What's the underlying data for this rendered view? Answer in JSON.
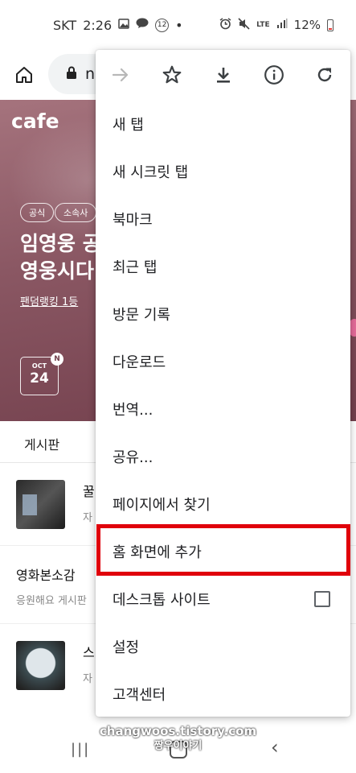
{
  "status_bar": {
    "carrier": "SKT",
    "time": "2:26",
    "icons_left": [
      "image-icon",
      "talk-icon"
    ],
    "notification_count": "12",
    "dot": "•",
    "icons_right": [
      "alarm-icon",
      "mute-icon",
      "lte-icon",
      "signal-icon"
    ],
    "lte_label": "LTE",
    "battery_percent": "12%",
    "battery_icon": "battery-low-icon"
  },
  "toolbar": {
    "home_icon": "home-icon",
    "lock_icon": "lock-icon",
    "url_text": "n"
  },
  "page": {
    "logo": "cafe",
    "chips": [
      "공식",
      "소속사"
    ],
    "title": "임영웅 공\n영웅시다",
    "rank_text": "팬덤랭킹 1등",
    "calendar": {
      "month": "OCT",
      "day": "24",
      "badge": "N"
    },
    "tab_label": "게시판",
    "posts": [
      {
        "title": "꿀",
        "subtitle": "자"
      },
      {
        "title": "영화본소감",
        "subtitle": "응원해요 게시판"
      },
      {
        "title": "스",
        "subtitle": "자"
      }
    ]
  },
  "menu": {
    "icon_row": [
      "forward-icon",
      "star-icon",
      "download-icon",
      "info-icon",
      "refresh-icon"
    ],
    "items": [
      {
        "label": "새 탭"
      },
      {
        "label": "새 시크릿 탭"
      },
      {
        "label": "북마크"
      },
      {
        "label": "최근 탭"
      },
      {
        "label": "방문 기록"
      },
      {
        "label": "다운로드"
      },
      {
        "label": "번역..."
      },
      {
        "label": "공유..."
      },
      {
        "label": "페이지에서 찾기"
      },
      {
        "label": "홈 화면에 추가",
        "highlighted": true
      },
      {
        "label": "데스크톱 사이트",
        "checkbox": false
      },
      {
        "label": "설정"
      },
      {
        "label": "고객센터"
      }
    ]
  },
  "watermark": {
    "line1": "changwoos.tistory.com",
    "line2": "짱우이야기"
  },
  "nav_bar": {
    "icons": [
      "recent-apps-icon",
      "home-icon",
      "back-icon"
    ]
  },
  "colors": {
    "highlight": "#e0000b",
    "banner": "#8a5763",
    "icon": "#3c4043"
  }
}
